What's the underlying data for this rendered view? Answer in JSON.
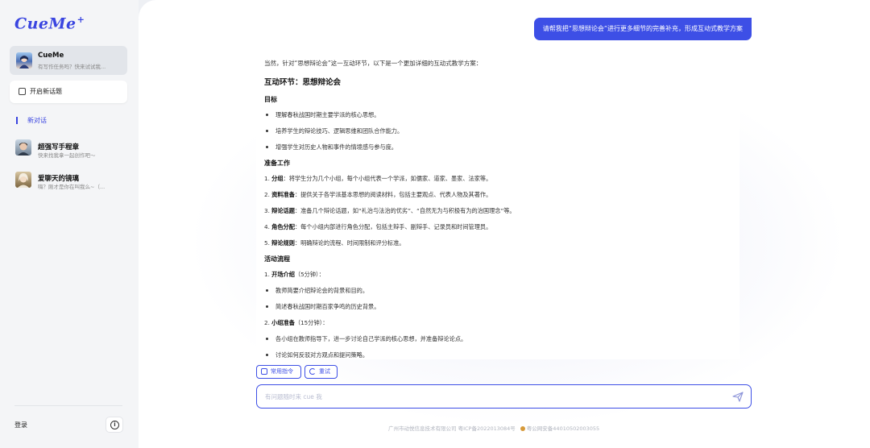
{
  "app": {
    "logo": "CueMe"
  },
  "sidebar": {
    "active_card": {
      "name": "CueMe",
      "subtitle": "有写作任务吗？快来试试我..."
    },
    "new_topic_label": "开启新话题",
    "new_chat_label": "新对话",
    "bots": [
      {
        "name": "超强写手程章",
        "subtitle": "快来找我拿一起创作吧～"
      },
      {
        "name": "爱聊天的镜璃",
        "subtitle": "嗨？刚才是你在叫我么~（..."
      }
    ],
    "login_label": "登录",
    "info_icon": "info-icon"
  },
  "chat": {
    "user_message": "请帮我把“思想辩论会”进行更多细节的完善补充，形成互动式教学方案",
    "answer": {
      "intro": "当然，针对“思想辩论会”这一互动环节，以下是一个更加详细的互动式教学方案：",
      "title": "互动环节：思想辩论会",
      "sections": [
        {
          "heading": "目标",
          "items": [
            {
              "marker": "•",
              "bold": "",
              "text": "理解春秋战国时期主要学派的核心思想。"
            },
            {
              "marker": "•",
              "bold": "",
              "text": "培养学生的辩论技巧、逻辑思维和团队合作能力。"
            },
            {
              "marker": "•",
              "bold": "",
              "text": "增强学生对历史人物和事件的情境感与参与度。"
            }
          ]
        },
        {
          "heading": "准备工作",
          "items": [
            {
              "marker": "1.",
              "bold": "分组",
              "text": "：将学生分为几个小组，每个小组代表一个学派，如儒家、道家、墨家、法家等。"
            },
            {
              "marker": "2.",
              "bold": "资料准备",
              "text": "：提供关于各学派基本思想的阅读材料，包括主要观点、代表人物及其著作。"
            },
            {
              "marker": "3.",
              "bold": "辩论话题",
              "text": "：准备几个辩论话题，如“礼治与法治的优劣”、“自然无为与积极有为的治国理念”等。"
            },
            {
              "marker": "4.",
              "bold": "角色分配",
              "text": "：每个小组内部进行角色分配，包括主辩手、副辩手、记录员和时间管理员。"
            },
            {
              "marker": "5.",
              "bold": "辩论规则",
              "text": "：明确辩论的流程、时间限制和评分标准。"
            }
          ]
        },
        {
          "heading": "活动流程",
          "items": [
            {
              "marker": "1.",
              "bold": "开场介绍",
              "text": "（5分钟）："
            },
            {
              "marker": "•",
              "bold": "",
              "text": "教师简要介绍辩论会的背景和目的。"
            },
            {
              "marker": "•",
              "bold": "",
              "text": "简述春秋战国时期百家争鸣的历史背景。"
            },
            {
              "marker": "2.",
              "bold": "小组准备",
              "text": "（15分钟）："
            },
            {
              "marker": "•",
              "bold": "",
              "text": "各小组在教师指导下，进一步讨论自己学派的核心思想，并准备辩论论点。"
            },
            {
              "marker": "•",
              "bold": "",
              "text": "讨论如何反驳对方观点和提问策略。"
            }
          ]
        }
      ]
    },
    "chips": [
      {
        "label": "常用指令",
        "icon": "command-icon"
      },
      {
        "label": "重试",
        "icon": "refresh-icon"
      }
    ],
    "input_placeholder": "有问题随时来 cue 我",
    "send_icon": "send-icon",
    "footer": {
      "company": "广州市动悦信息技术有限公司 粤ICP备2022013084号",
      "police": "粤公网安备44010502003055"
    }
  },
  "colors": {
    "accent": "#3d4fe6",
    "sidebar_bg": "#f4f5f7"
  }
}
